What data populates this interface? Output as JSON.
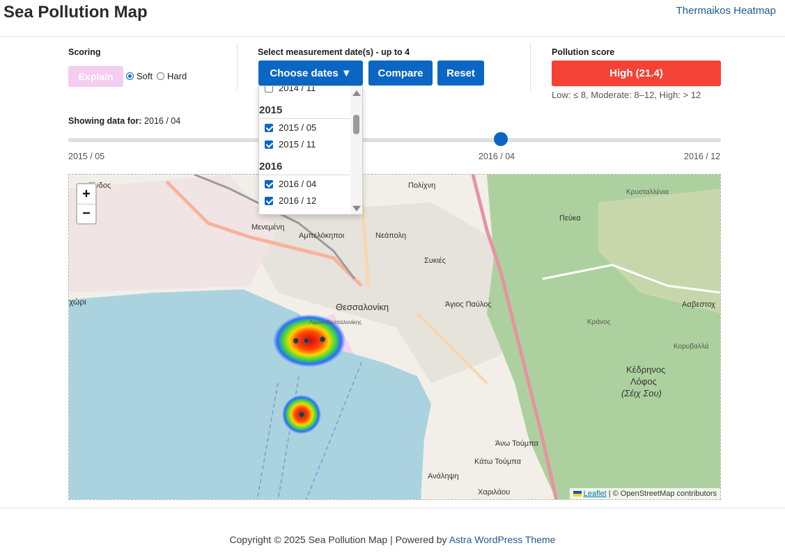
{
  "header": {
    "title": "Sea Pollution Map",
    "nav_link": "Thermaikos Heatmap"
  },
  "scoring": {
    "label": "Scoring",
    "explain_label": "Explain",
    "soft_label": "Soft",
    "hard_label": "Hard",
    "selected": "Soft"
  },
  "dates": {
    "label": "Select measurement date(s) - up to 4",
    "choose_label": "Choose dates ▼",
    "compare_label": "Compare",
    "reset_label": "Reset",
    "dropdown": {
      "partial_item": "2014 / 11",
      "groups": [
        {
          "year": "2015",
          "items": [
            {
              "label": "2015 / 05",
              "checked": true
            },
            {
              "label": "2015 / 11",
              "checked": true
            }
          ]
        },
        {
          "year": "2016",
          "items": [
            {
              "label": "2016 / 04",
              "checked": true
            },
            {
              "label": "2016 / 12",
              "checked": true
            }
          ]
        }
      ]
    }
  },
  "score": {
    "label": "Pollution score",
    "value": "High (21.4)",
    "legend": "Low: ≤ 8, Moderate: 8–12, High: > 12",
    "color": "#f44336"
  },
  "showing": {
    "prefix": "Showing data for:",
    "value": "2016 / 04"
  },
  "slider": {
    "ticks": [
      "2015 / 05",
      "2016 / 04",
      "2016 / 12"
    ],
    "current": "2016 / 04"
  },
  "map": {
    "zoom_in": "+",
    "zoom_out": "−",
    "attribution_link": "Leaflet",
    "attribution_text": "| © OpenStreetMap contributors",
    "labels": {
      "thessaloniki": "Θεσσαλονίκη",
      "menemeni": "Μενεμένη",
      "ampelokipoi": "Αμπελόκηποι",
      "neapoli": "Νεάπολη",
      "sykies": "Συκιές",
      "agios_pavlos": "Άγιος Παύλος",
      "polichni": "Πολίχνη",
      "peuka": "Πεύκα",
      "asvestochori": "Ασβεστοχ",
      "kedrinos": "Κέδρηνος",
      "lofos": "Λόφος",
      "seich_sou": "(Σέιχ Σου)",
      "ano_toumpa": "Άνω Τούμπα",
      "kato_toumpa": "Κάτω Τούμπα",
      "analipsi": "Ανάληψη",
      "charilaou": "Χαριλάου",
      "limani": "Λιμάνι Θεσσαλονίκης",
      "kalochori": "χώρι",
      "krystallenia": "Κρυσταλλένια",
      "kranos": "Κράνος",
      "kourbala": "Κορυβαλλά",
      "sindos": "Σίνδος"
    }
  },
  "footer": {
    "text": "Copyright © 2025 Sea Pollution Map | Powered by",
    "link": "Astra WordPress Theme"
  }
}
